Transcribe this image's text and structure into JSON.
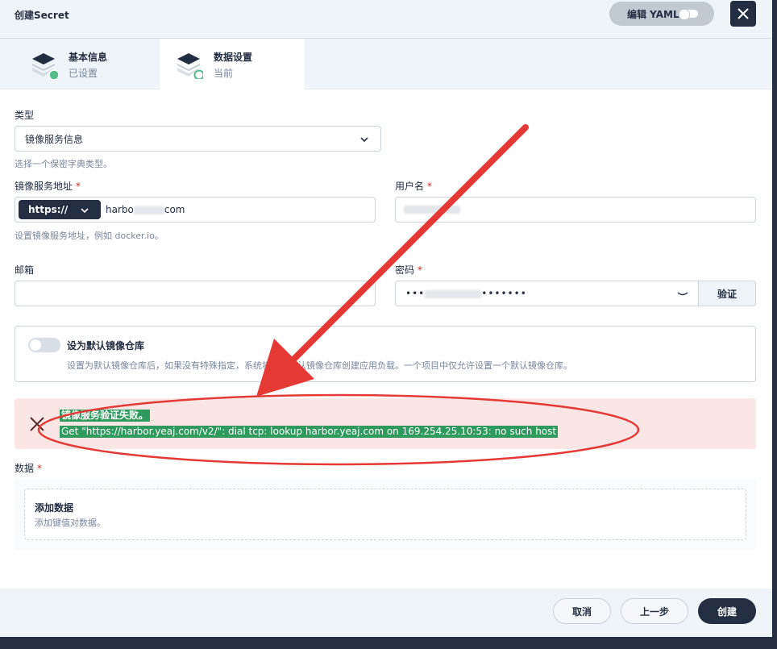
{
  "header": {
    "title": "创建Secret",
    "yaml_label": "编辑 YAML"
  },
  "steps": [
    {
      "name": "基本信息",
      "status": "已设置"
    },
    {
      "name": "数据设置",
      "status": "当前"
    }
  ],
  "form": {
    "type_label": "类型",
    "type_value": "镜像服务信息",
    "type_hint": "选择一个保密字典类型。",
    "registry_label": "镜像服务地址",
    "protocol": "https://",
    "registry_prefix": "harbo",
    "registry_suffix": "com",
    "registry_hint": "设置镜像服务地址，例如 docker.io。",
    "username_label": "用户名",
    "email_label": "邮箱",
    "password_label": "密码",
    "password_prefix": "•••",
    "password_suffix": "•••••••",
    "verify_label": "验证",
    "required_mark": "*"
  },
  "default_repo": {
    "title": "设为默认镜像仓库",
    "description": "设置为默认镜像仓库后，如果没有特殊指定，系统将使用默认镜像仓库创建应用负载。一个项目中仅允许设置一个默认镜像仓库。"
  },
  "error": {
    "title": "镜像服务验证失败。",
    "message": "Get \"https://harbor.yeaj.com/v2/\": dial tcp: lookup harbor.yeaj.com on 169.254.25.10:53: no such host"
  },
  "data_section": {
    "label": "数据",
    "add_title": "添加数据",
    "add_hint": "添加键值对数据。"
  },
  "footer": {
    "cancel": "取消",
    "previous": "上一步",
    "create": "创建"
  },
  "colors": {
    "primary_dark": "#242e42",
    "success_green": "#55bc8a",
    "error_bg": "#fae7e5",
    "annotation_red": "#e53935"
  }
}
